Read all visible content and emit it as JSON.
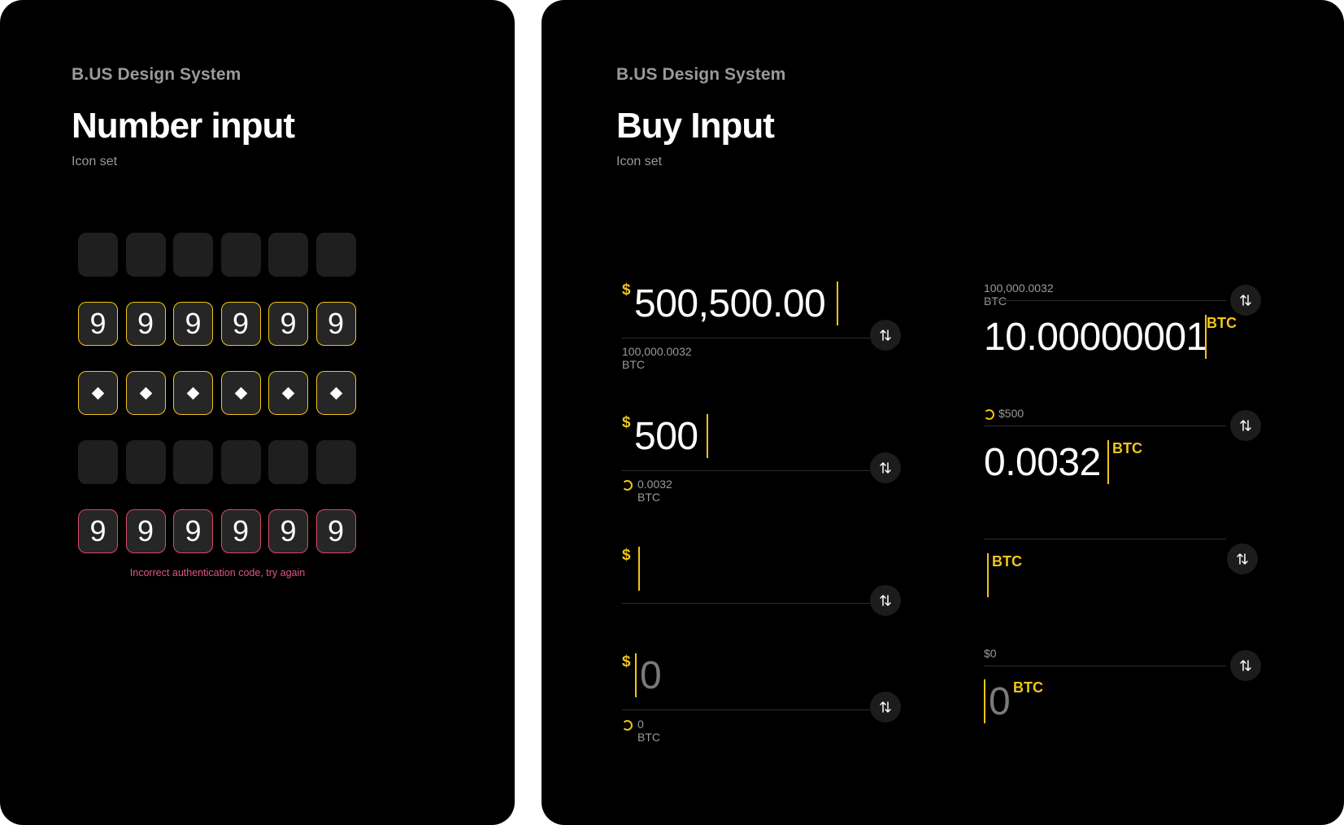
{
  "left": {
    "brand": "B.US Design System",
    "title": "Number input",
    "subtitle": "Icon set",
    "rows": {
      "filled": [
        "9",
        "9",
        "9",
        "9",
        "9",
        "9"
      ],
      "error": [
        "9",
        "9",
        "9",
        "9",
        "9",
        "9"
      ]
    },
    "error_message": "Incorrect authentication code, try again"
  },
  "right": {
    "brand": "B.US Design System",
    "title": "Buy Input",
    "subtitle": "Icon set",
    "usd_fields": [
      {
        "currency": "$",
        "value": "500,500.00",
        "sub": "100,000.0032 BTC"
      },
      {
        "currency": "$",
        "value": "500",
        "sub": "0.0032 BTC"
      },
      {
        "currency": "$",
        "value": "",
        "sub": ""
      },
      {
        "currency": "$",
        "value": "0",
        "sub": "0 BTC"
      }
    ],
    "btc_fields": [
      {
        "top": "100,000.0032 BTC",
        "value": "10.00000001",
        "unit": "BTC"
      },
      {
        "top": "$500",
        "value": "0.0032",
        "unit": "BTC"
      },
      {
        "top": "",
        "value": "",
        "unit": "BTC"
      },
      {
        "top": "$0",
        "value": "0",
        "unit": "BTC"
      }
    ]
  },
  "icons": {
    "swap": "swap-vertical-icon",
    "loading": "loading-spinner-icon"
  },
  "colors": {
    "accent": "#f0c419",
    "error": "#d94a6a",
    "background": "#000000"
  }
}
